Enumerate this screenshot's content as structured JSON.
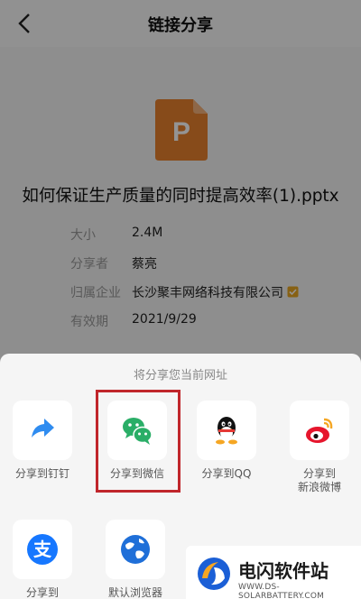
{
  "header": {
    "title": "链接分享",
    "back_icon": "chevron-left-icon"
  },
  "file": {
    "icon": "ppt-file-icon",
    "icon_letter": "P",
    "name": "如何保证生产质量的同时提高效率(1).pptx",
    "color": "#e8812e"
  },
  "info": [
    {
      "label": "大小",
      "value": "2.4M"
    },
    {
      "label": "分享者",
      "value": "蔡亮"
    },
    {
      "label": "归属企业",
      "value": "长沙聚丰网络科技有限公司",
      "verified": true
    },
    {
      "label": "有效期",
      "value": "2021/9/29"
    }
  ],
  "sheet": {
    "title": "将分享您当前网址",
    "items": [
      {
        "label": "分享到钉钉",
        "icon": "dingtalk-icon"
      },
      {
        "label": "分享到微信",
        "icon": "wechat-icon"
      },
      {
        "label": "分享到QQ",
        "icon": "qq-icon"
      },
      {
        "label": "分享到\n新浪微博",
        "icon": "weibo-icon"
      },
      {
        "label": "分享到",
        "icon": "alipay-icon"
      },
      {
        "label": "默认浏览器",
        "icon": "browser-icon"
      }
    ]
  },
  "watermark": {
    "brand": "电闪软件站",
    "domain": "WWW.DS-SOLARBATTERY.COM"
  },
  "colors": {
    "highlight": "#c0262b",
    "wechat": "#2aae67",
    "alipay": "#1677ff"
  }
}
